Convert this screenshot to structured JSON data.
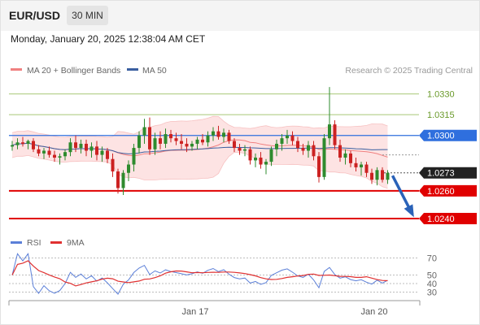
{
  "header": {
    "symbol": "EUR/USD",
    "timeframe": "30 MIN",
    "datetime": "Monday, January 20, 2025 12:38:04 AM CET"
  },
  "legend": {
    "bollinger_label": "MA 20 + Bollinger Bands",
    "ma50_label": "MA 50",
    "credit": "Research © 2025 Trading Central",
    "rsi_label": "RSI",
    "rsi_ma_label": "9MA"
  },
  "colors": {
    "bollinger": "#f08080",
    "bollinger_fill": "#fde3e3",
    "ma50": "#3a5fa0",
    "resistance": "#a8c878",
    "pivot_fill": "#2f6fde",
    "support": "#e00000",
    "current_fill": "#222222",
    "bull": "#2e8b2e",
    "bear": "#cc2222",
    "rsi": "#5b7fd8",
    "rsi_ma": "#e03030",
    "arrow": "#2a62b8"
  },
  "chart_data": [
    {
      "type": "candlestick",
      "title": "EUR/USD 30 MIN",
      "ylim": [
        1.023,
        1.0338
      ],
      "x_ticks": [
        "Jan 17",
        "Jan 20"
      ],
      "series": [
        {
          "name": "MA 20 + Bollinger Bands"
        },
        {
          "name": "MA 50"
        }
      ],
      "candles": [
        [
          1.0292,
          1.0296,
          1.0289,
          1.0293
        ],
        [
          1.0293,
          1.0298,
          1.029,
          1.0295
        ],
        [
          1.0295,
          1.0299,
          1.0292,
          1.0294
        ],
        [
          1.0294,
          1.0297,
          1.029,
          1.0296
        ],
        [
          1.0296,
          1.0298,
          1.0288,
          1.029
        ],
        [
          1.029,
          1.0293,
          1.0285,
          1.0287
        ],
        [
          1.0287,
          1.0291,
          1.0283,
          1.0289
        ],
        [
          1.0289,
          1.0292,
          1.0284,
          1.0286
        ],
        [
          1.0286,
          1.0289,
          1.0281,
          1.0284
        ],
        [
          1.0284,
          1.0287,
          1.0279,
          1.0285
        ],
        [
          1.0285,
          1.029,
          1.0282,
          1.0288
        ],
        [
          1.0288,
          1.0298,
          1.0285,
          1.0295
        ],
        [
          1.0295,
          1.03,
          1.0288,
          1.0291
        ],
        [
          1.0291,
          1.0297,
          1.0287,
          1.0294
        ],
        [
          1.0294,
          1.0297,
          1.0285,
          1.0289
        ],
        [
          1.0289,
          1.0295,
          1.0284,
          1.0292
        ],
        [
          1.0292,
          1.0296,
          1.0282,
          1.0286
        ],
        [
          1.0286,
          1.0292,
          1.0281,
          1.0289
        ],
        [
          1.0289,
          1.0291,
          1.028,
          1.0283
        ],
        [
          1.0283,
          1.0287,
          1.027,
          1.0274
        ],
        [
          1.0274,
          1.0276,
          1.0258,
          1.0262
        ],
        [
          1.0262,
          1.0275,
          1.0257,
          1.0273
        ],
        [
          1.0273,
          1.0282,
          1.0267,
          1.0279
        ],
        [
          1.0279,
          1.0294,
          1.0274,
          1.0291
        ],
        [
          1.0291,
          1.0303,
          1.0287,
          1.03
        ],
        [
          1.03,
          1.0312,
          1.0294,
          1.0306
        ],
        [
          1.0306,
          1.0313,
          1.0286,
          1.029
        ],
        [
          1.029,
          1.0302,
          1.0286,
          1.0298
        ],
        [
          1.0298,
          1.0303,
          1.029,
          1.0294
        ],
        [
          1.0294,
          1.0305,
          1.0291,
          1.0301
        ],
        [
          1.0301,
          1.0304,
          1.0295,
          1.0298
        ],
        [
          1.0298,
          1.0302,
          1.0293,
          1.0296
        ],
        [
          1.0296,
          1.0301,
          1.029,
          1.0294
        ],
        [
          1.0294,
          1.0298,
          1.0288,
          1.0292
        ],
        [
          1.0292,
          1.0296,
          1.0289,
          1.0294
        ],
        [
          1.0294,
          1.0299,
          1.029,
          1.0297
        ],
        [
          1.0297,
          1.0301,
          1.0293,
          1.0295
        ],
        [
          1.0295,
          1.0303,
          1.0292,
          1.03
        ],
        [
          1.03,
          1.0306,
          1.0296,
          1.0303
        ],
        [
          1.0303,
          1.0307,
          1.0297,
          1.0299
        ],
        [
          1.0299,
          1.0305,
          1.0295,
          1.0302
        ],
        [
          1.0302,
          1.0304,
          1.0294,
          1.0296
        ],
        [
          1.0296,
          1.0298,
          1.0288,
          1.0291
        ],
        [
          1.0291,
          1.0294,
          1.0286,
          1.0289
        ],
        [
          1.0289,
          1.0293,
          1.0285,
          1.029
        ],
        [
          1.029,
          1.0292,
          1.0279,
          1.0282
        ],
        [
          1.0282,
          1.0287,
          1.0277,
          1.0284
        ],
        [
          1.0284,
          1.0288,
          1.0276,
          1.0279
        ],
        [
          1.0279,
          1.0283,
          1.0272,
          1.0281
        ],
        [
          1.0281,
          1.0292,
          1.0278,
          1.029
        ],
        [
          1.029,
          1.0297,
          1.0285,
          1.0294
        ],
        [
          1.0294,
          1.0301,
          1.0289,
          1.0298
        ],
        [
          1.0298,
          1.0304,
          1.0294,
          1.03
        ],
        [
          1.03,
          1.0303,
          1.0293,
          1.0296
        ],
        [
          1.0296,
          1.0299,
          1.0288,
          1.0291
        ],
        [
          1.0291,
          1.0294,
          1.0286,
          1.0289
        ],
        [
          1.0289,
          1.0296,
          1.0284,
          1.0293
        ],
        [
          1.0293,
          1.0296,
          1.0282,
          1.0285
        ],
        [
          1.0285,
          1.0288,
          1.0266,
          1.027
        ],
        [
          1.027,
          1.0301,
          1.0268,
          1.0298
        ],
        [
          1.0298,
          1.0335,
          1.0293,
          1.0308
        ],
        [
          1.0308,
          1.0311,
          1.029,
          1.0293
        ],
        [
          1.0293,
          1.0297,
          1.0281,
          1.0284
        ],
        [
          1.0284,
          1.029,
          1.0279,
          1.0287
        ],
        [
          1.0287,
          1.0289,
          1.0277,
          1.028
        ],
        [
          1.028,
          1.0284,
          1.0274,
          1.0277
        ],
        [
          1.0277,
          1.0281,
          1.0271,
          1.0279
        ],
        [
          1.0279,
          1.0281,
          1.027,
          1.0273
        ],
        [
          1.0273,
          1.0276,
          1.0265,
          1.0268
        ],
        [
          1.0268,
          1.0277,
          1.0264,
          1.0275
        ],
        [
          1.0275,
          1.0277,
          1.0266,
          1.0268
        ],
        [
          1.0268,
          1.0275,
          1.0265,
          1.0273
        ]
      ]
    },
    {
      "type": "line",
      "title": "RSI",
      "ylim": [
        20,
        80
      ],
      "y_ticks": [
        70,
        50,
        40,
        30
      ],
      "series": [
        {
          "name": "RSI"
        },
        {
          "name": "9MA"
        }
      ]
    }
  ],
  "levels": {
    "resistance": [
      "1.0330",
      "1.0315"
    ],
    "pivot": "1.0300",
    "current": "1.0273",
    "support": [
      "1.0260",
      "1.0240"
    ]
  }
}
